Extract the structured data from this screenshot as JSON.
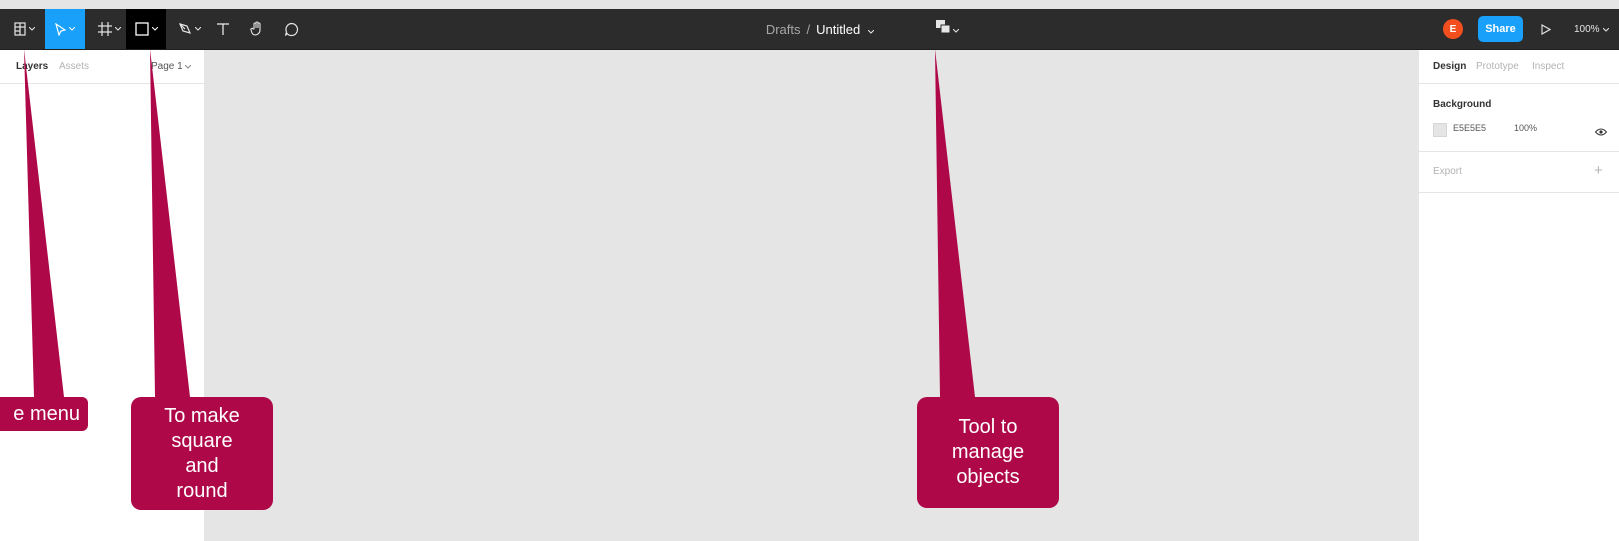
{
  "toolbar": {
    "breadcrumb_parent": "Drafts",
    "breadcrumb_separator": "/",
    "file_name": "Untitled",
    "avatar_initial": "E",
    "share_label": "Share",
    "zoom_label": "100%",
    "accent_color": "#18a0fb",
    "tools": [
      "main-menu",
      "move",
      "frame",
      "rectangle",
      "pen",
      "text",
      "hand",
      "comment",
      "object-tool"
    ]
  },
  "left_panel": {
    "tabs": [
      {
        "label": "Layers",
        "active": true
      },
      {
        "label": "Assets",
        "active": false
      }
    ],
    "page_selector": "Page 1"
  },
  "right_panel": {
    "tabs": [
      {
        "label": "Design",
        "active": true
      },
      {
        "label": "Prototype",
        "active": false
      },
      {
        "label": "Inspect",
        "active": false
      }
    ],
    "background": {
      "title": "Background",
      "hex": "E5E5E5",
      "opacity": "100%"
    },
    "export": {
      "title": "Export"
    }
  },
  "callouts": {
    "menu": "e menu",
    "shapes": [
      "To make",
      "square",
      "and",
      "round"
    ],
    "objects": [
      "Tool to",
      "manage",
      "objects"
    ],
    "color": "#ae0849"
  }
}
